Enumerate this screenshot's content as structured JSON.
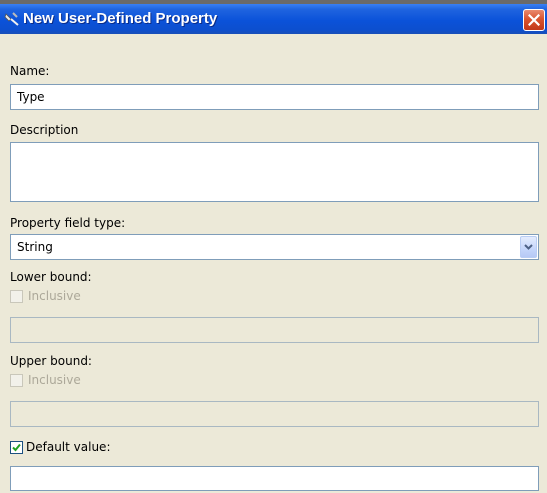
{
  "window": {
    "title": "New User-Defined Property",
    "icon": "tool-icon",
    "close_icon": "close-icon"
  },
  "form": {
    "name": {
      "label": "Name:",
      "value": "Type"
    },
    "description": {
      "label": "Description",
      "value": ""
    },
    "field_type": {
      "label": "Property field type:",
      "value": "String"
    },
    "lower_bound": {
      "label": "Lower bound:",
      "inclusive_label": "Inclusive",
      "inclusive_checked": false,
      "value": ""
    },
    "upper_bound": {
      "label": "Upper bound:",
      "inclusive_label": "Inclusive",
      "inclusive_checked": false,
      "value": ""
    },
    "default_value": {
      "label": "Default value:",
      "checked": true,
      "value": ""
    }
  },
  "colors": {
    "title_bar": "#0b52d9",
    "close_button": "#d9542f",
    "dialog_background": "#ece9d8",
    "field_border": "#7f9db9",
    "checkmark": "#21a121"
  }
}
